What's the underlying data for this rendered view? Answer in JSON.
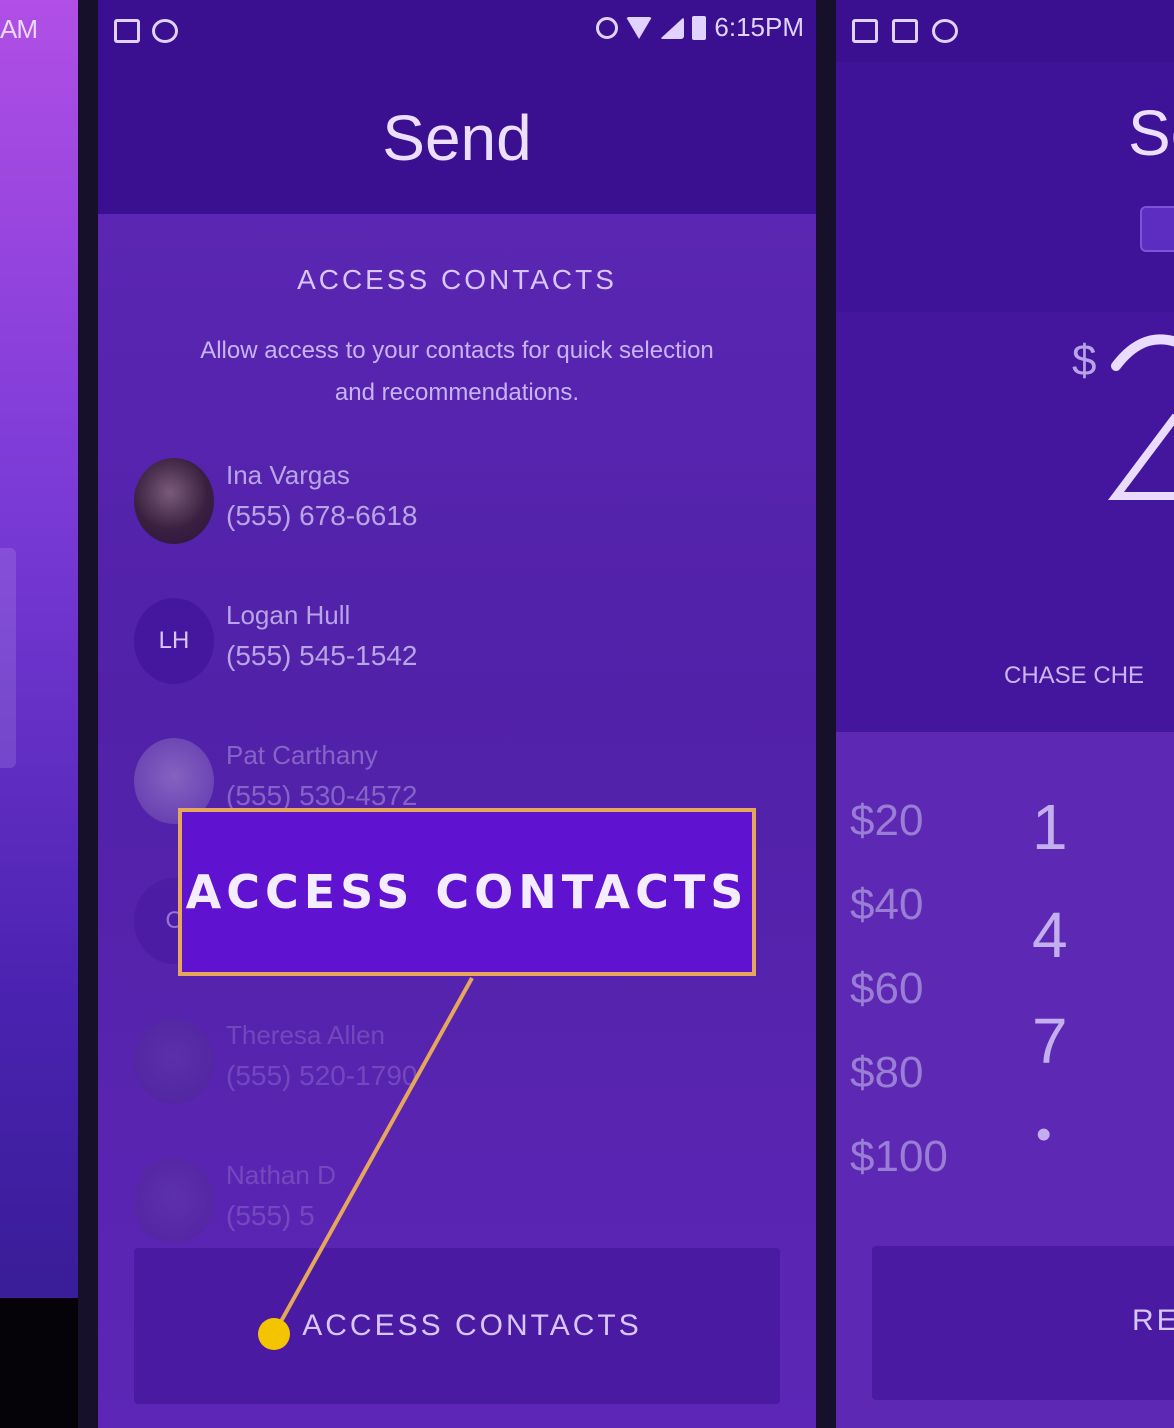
{
  "left_phone": {
    "time": "AM"
  },
  "main_phone": {
    "status_bar": {
      "time": "6:15PM"
    },
    "header": {
      "title": "Send"
    },
    "permission": {
      "title": "ACCESS CONTACTS",
      "description": "Allow access to your contacts for quick selection and recommendations."
    },
    "contacts": [
      {
        "name": "Ina Vargas",
        "phone": "(555) 678-6618",
        "initials": ""
      },
      {
        "name": "Logan Hull",
        "phone": "(555) 545-1542",
        "initials": "LH"
      },
      {
        "name": "Pat Carthany",
        "phone": "(555) 530-4572",
        "initials": ""
      },
      {
        "name": "",
        "phone": "",
        "initials": "C"
      },
      {
        "name": "Theresa Allen",
        "phone": "(555) 520-1790",
        "initials": ""
      },
      {
        "name": "Nathan D",
        "phone": "(555) 5",
        "initials": ""
      }
    ],
    "button": {
      "label": "ACCESS CONTACTS"
    }
  },
  "callout": {
    "label": "ACCESS CONTACTS",
    "border_color": "#e6a75a",
    "dot_color": "#f5c400"
  },
  "right_phone": {
    "title": "Se",
    "currency_symbol": "$",
    "amount": "2",
    "bank_label": "CHASE CHE",
    "quick_amounts": [
      "$20",
      "$40",
      "$60",
      "$80",
      "$100"
    ],
    "keypad": [
      "1",
      "4",
      "7",
      "•"
    ],
    "request_button": "RE"
  }
}
